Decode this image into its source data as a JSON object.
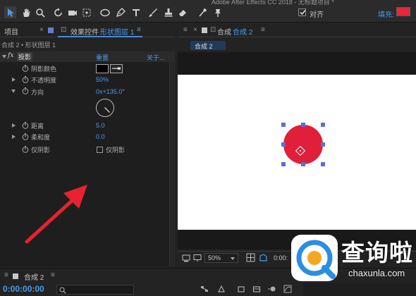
{
  "app": {
    "window_title": "Adobe After Effects CC 2018 - 无标题项目 *"
  },
  "toolbar": {
    "tools": [
      "selection-tool",
      "hand-tool",
      "zoom-tool",
      "rotate-tool",
      "camera-tool",
      "pan-behind-tool",
      "ellipse-tool",
      "pen-tool",
      "text-tool",
      "brush-tool",
      "clone-stamp-tool",
      "eraser-tool",
      "roto-brush-tool",
      "puppet-pin-tool"
    ],
    "snap_label": "对齐",
    "snap_checked": true,
    "fill_label": "填充:",
    "fill_color": "#e8273b"
  },
  "left_panel": {
    "tab_project": "项目",
    "tab_effects_prefix": "效果控件",
    "tab_effects_layer": "形状图层 1",
    "comp_path": "合成 2 • 形状图层 1",
    "fx_label": "fx",
    "effect_name": "投影",
    "reset_label": "重置",
    "about_label": "关于...",
    "properties": [
      {
        "label": "阴影颜色",
        "value": ""
      },
      {
        "label": "不透明度",
        "value": "50%"
      },
      {
        "label": "方向",
        "value": "0x+135.0°"
      },
      {
        "label": "距离",
        "value": "5.0"
      },
      {
        "label": "柔和度",
        "value": "0.0"
      },
      {
        "label": "仅阴影",
        "value": "仅阴影"
      }
    ],
    "shadow_color": "#000000"
  },
  "comp_panel": {
    "tab_prefix": "合成",
    "tab_name": "合成 2",
    "breadcrumb": "合成 2",
    "zoom": "50%",
    "time": "0:00:",
    "shape_color": "#e01f3a"
  },
  "timeline": {
    "tab": "合成 2",
    "timecode": "0:00:00:00"
  },
  "watermark": {
    "title": "查询啦",
    "url": "chaxunla.com"
  },
  "annotation": {
    "arrow_color": "#e8222e"
  }
}
